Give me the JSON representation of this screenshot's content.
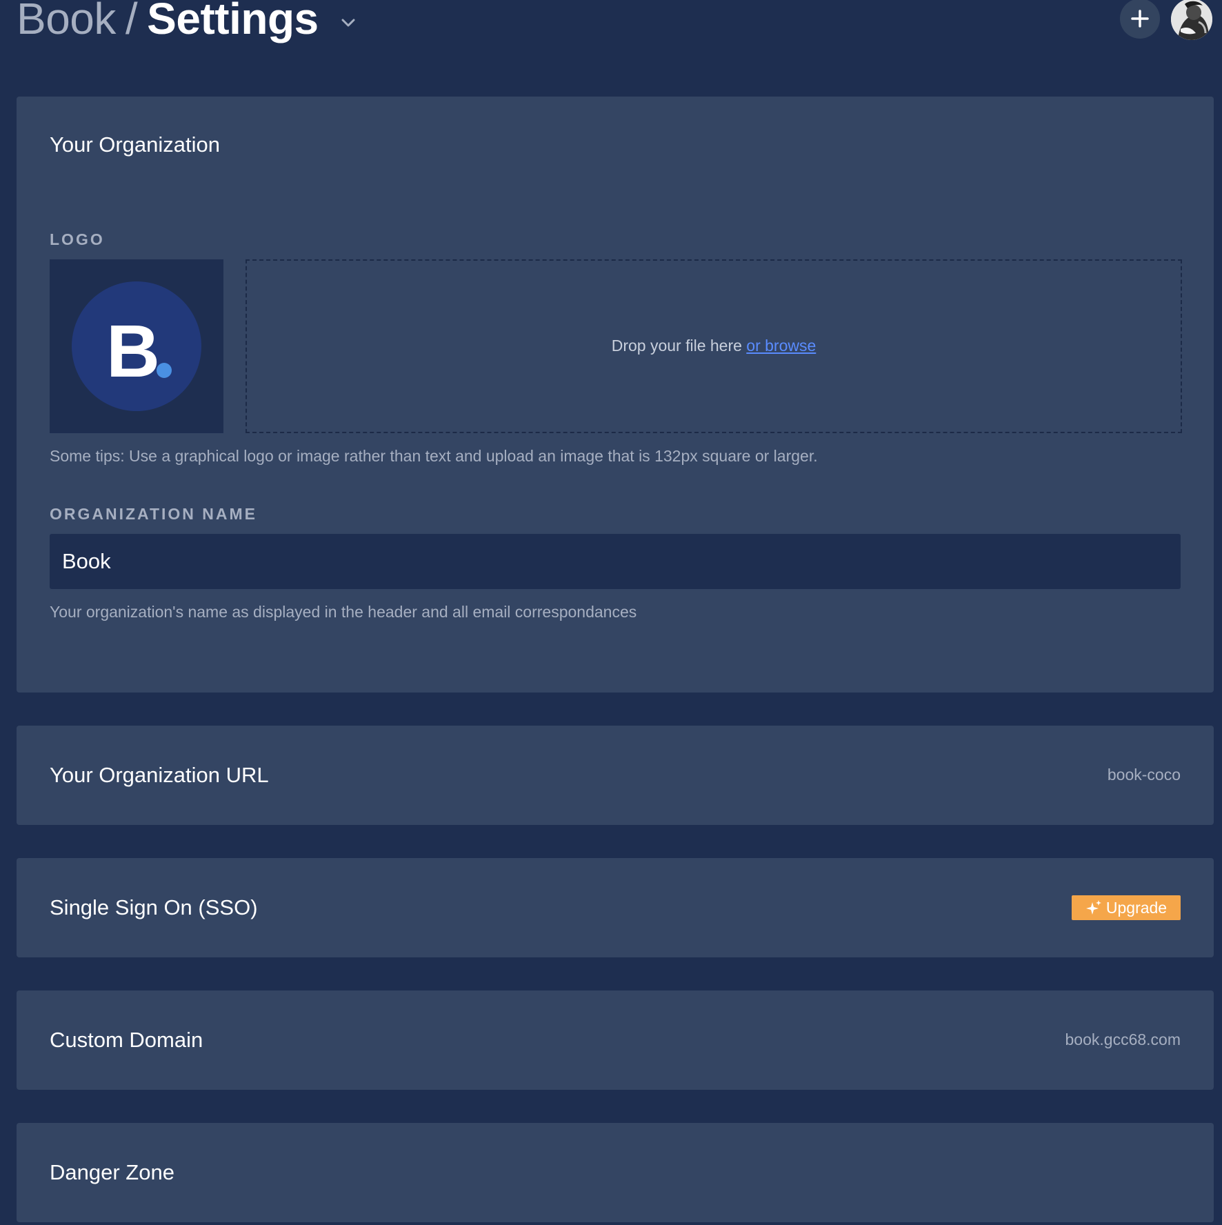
{
  "header": {
    "org_name": "Book",
    "separator": "/",
    "page_title": "Settings",
    "add_button_icon": "plus-icon",
    "menu_icon": "chevron-down-icon"
  },
  "organization": {
    "section_title": "Your Organization",
    "logo_label": "LOGO",
    "logo_text": "B.",
    "dropzone_text": "Drop your file here",
    "dropzone_link": "or browse",
    "logo_tips": "Some tips: Use a graphical logo or image rather than text and upload an image that is 132px square or larger.",
    "name_label": "ORGANIZATION NAME",
    "name_value": "Book",
    "name_help": "Your organization's name as displayed in the header and all email correspondances"
  },
  "url_section": {
    "title": "Your Organization URL",
    "value": "book-coco"
  },
  "sso_section": {
    "title": "Single Sign On (SSO)",
    "upgrade_label": "Upgrade",
    "upgrade_icon": "sparkle-icon"
  },
  "domain_section": {
    "title": "Custom Domain",
    "value": "book.gcc68.com"
  },
  "danger_section": {
    "title": "Danger Zone"
  },
  "colors": {
    "background": "#1e2e50",
    "card": "#344563",
    "link": "#5a8cff",
    "upgrade": "#f5a64a",
    "logo_circle": "#22397a",
    "logo_dot": "#4a90e2"
  }
}
